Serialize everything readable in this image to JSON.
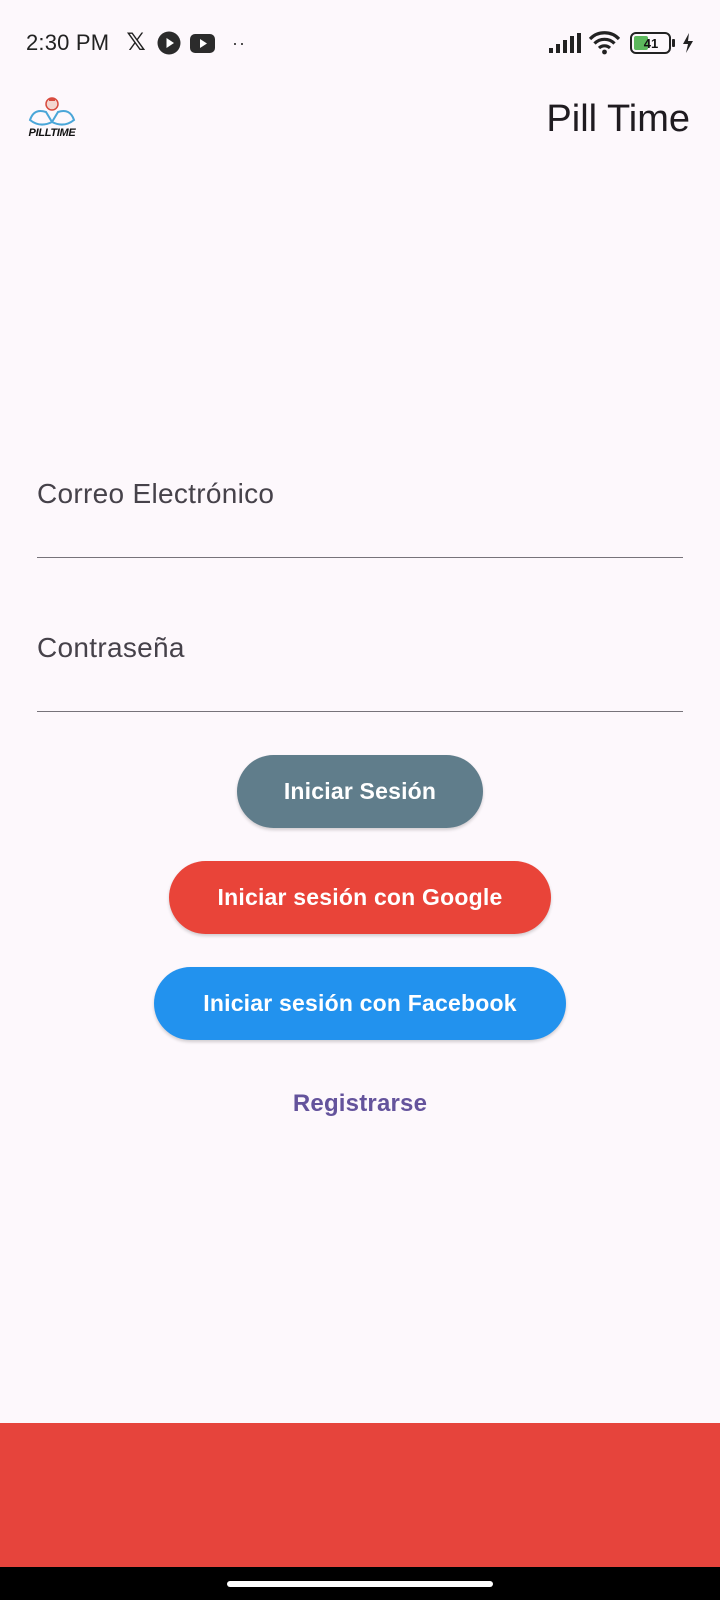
{
  "status_bar": {
    "time": "2:30 PM",
    "x_glyph": "𝕏",
    "more": "··",
    "battery_level": "41",
    "icons": [
      "x-icon",
      "play-circle-icon",
      "youtube-icon",
      "more-dots-icon",
      "signal-icon",
      "wifi-icon",
      "battery-icon",
      "charging-icon"
    ]
  },
  "app_bar": {
    "logo_text": "PILLTIME",
    "title": "Pill Time"
  },
  "form": {
    "email_label": "Correo Electrónico",
    "password_label": "Contraseña"
  },
  "buttons": {
    "login": "Iniciar Sesión",
    "google": "Iniciar sesión con Google",
    "facebook": "Iniciar sesión con Facebook",
    "register": "Registrarse"
  },
  "colors": {
    "background": "#fdf8fc",
    "login_button": "#607d8b",
    "google_button": "#e94439",
    "facebook_button": "#2292ee",
    "register_link": "#64539c",
    "bottom_panel": "#e6443c"
  }
}
